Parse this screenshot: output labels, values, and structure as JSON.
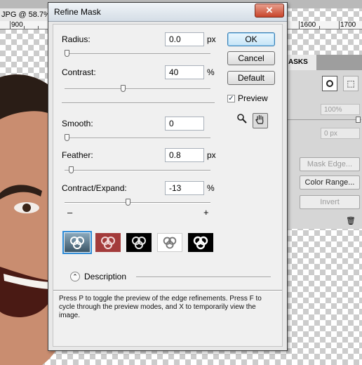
{
  "app": {
    "doc_tab": "JPG @ 58.7%",
    "ruler_labels": [
      "900",
      "1600",
      "1700"
    ]
  },
  "dialog": {
    "title": "Refine Mask",
    "close_glyph": "✕",
    "radius": {
      "label": "Radius:",
      "value": "0.0",
      "unit": "px",
      "level": 0.0
    },
    "contrast": {
      "label": "Contrast:",
      "value": "40",
      "unit": "%",
      "level": 0.4
    },
    "smooth": {
      "label": "Smooth:",
      "value": "0",
      "level": 0.0
    },
    "feather": {
      "label": "Feather:",
      "value": "0.8",
      "unit": "px",
      "level": 0.03
    },
    "contract_expand": {
      "label": "Contract/Expand:",
      "value": "-13",
      "unit": "%",
      "level": 0.435,
      "minus": "–",
      "plus": "+"
    },
    "buttons": {
      "ok": "OK",
      "cancel": "Cancel",
      "default": "Default"
    },
    "preview": {
      "label": "Preview",
      "checked": true
    },
    "tools": [
      "zoom-tool-icon",
      "hand-tool-icon"
    ],
    "view_modes": [
      "standard",
      "quick-mask",
      "on-black",
      "on-white",
      "mask"
    ],
    "selected_view": 0,
    "description": {
      "label": "Description",
      "text": "Press P to toggle the preview of the edge refinements. Press F to cycle through the preview modes, and X to temporarily view the image."
    }
  },
  "masks_panel": {
    "tab": "ASKS",
    "density": "100%",
    "feather": "0 px",
    "mask_edge": "Mask Edge...",
    "color_range": "Color Range...",
    "invert": "Invert"
  },
  "colors": {
    "accent": "#2c8ad6",
    "close": "#c7442b"
  }
}
